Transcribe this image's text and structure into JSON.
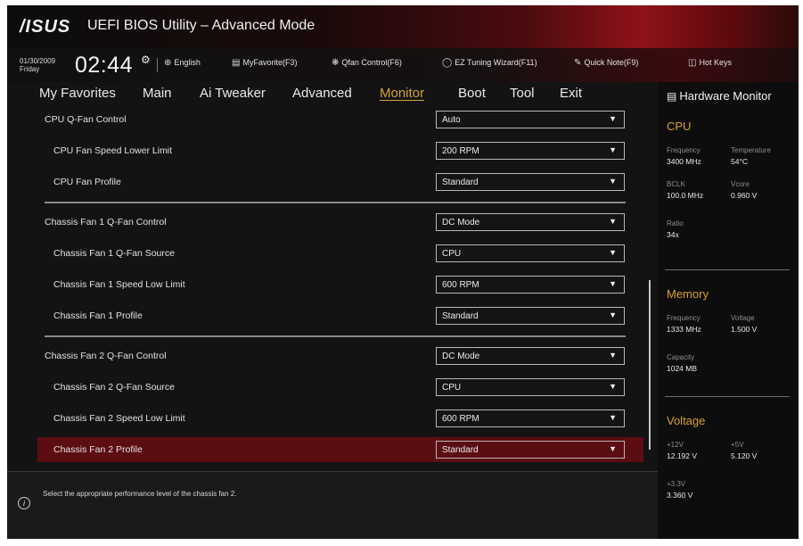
{
  "titlebar": {
    "logo": "/ISUS",
    "title": "UEFI BIOS Utility – Advanced Mode"
  },
  "toolbar": {
    "date": "01/30/2009",
    "day": "Friday",
    "time": "02:44",
    "items": [
      {
        "icon": "globe-icon",
        "label": "English"
      },
      {
        "icon": "favorites-icon",
        "label": "MyFavorite(F3)"
      },
      {
        "icon": "fan-icon",
        "label": "Qfan Control(F6)"
      },
      {
        "icon": "bulb-icon",
        "label": "EZ Tuning Wizard(F11)"
      },
      {
        "icon": "note-icon",
        "label": "Quick Note(F9)"
      },
      {
        "icon": "help-icon",
        "label": "Hot Keys"
      }
    ]
  },
  "tabs": [
    "My Favorites",
    "Main",
    "Ai Tweaker",
    "Advanced",
    "Monitor",
    "Boot",
    "Tool",
    "Exit"
  ],
  "active_tab": "Monitor",
  "settings": [
    {
      "label": "CPU Q-Fan Control",
      "value": "Auto"
    },
    {
      "label": "CPU Fan Speed Lower Limit",
      "value": "200 RPM"
    },
    {
      "label": "CPU Fan Profile",
      "value": "Standard"
    },
    {
      "label": "Chassis Fan 1 Q-Fan Control",
      "value": "DC Mode"
    },
    {
      "label": "Chassis Fan 1 Q-Fan Source",
      "value": "CPU"
    },
    {
      "label": "Chassis Fan 1 Speed Low Limit",
      "value": "600 RPM"
    },
    {
      "label": "Chassis Fan 1 Profile",
      "value": "Standard"
    },
    {
      "label": "Chassis Fan 2 Q-Fan Control",
      "value": "DC Mode"
    },
    {
      "label": "Chassis Fan 2 Q-Fan Source",
      "value": "CPU"
    },
    {
      "label": "Chassis Fan 2 Speed Low Limit",
      "value": "600 RPM"
    },
    {
      "label": "Chassis Fan 2 Profile",
      "value": "Standard"
    }
  ],
  "selected_setting": "Chassis Fan 2 Profile",
  "help_text": "Select the appropriate performance level of the chassis fan 2.",
  "hardware_monitor": {
    "title": "Hardware Monitor",
    "cpu": {
      "heading": "CPU",
      "frequency_label": "Frequency",
      "frequency": "3400 MHz",
      "temperature_label": "Temperature",
      "temperature": "54°C",
      "bclk_label": "BCLK",
      "bclk": "100.0 MHz",
      "vcore_label": "Vcore",
      "vcore": "0.960 V",
      "ratio_label": "Ratio",
      "ratio": "34x"
    },
    "memory": {
      "heading": "Memory",
      "frequency_label": "Frequency",
      "frequency": "1333 MHz",
      "voltage_label": "Voltage",
      "voltage": "1.500 V",
      "capacity_label": "Capacity",
      "capacity": "1024 MB"
    },
    "voltage": {
      "heading": "Voltage",
      "v12_label": "+12V",
      "v12": "12.192 V",
      "v5_label": "+5V",
      "v5": "5.120 V",
      "v33_label": "+3.3V",
      "v33": "3.360 V"
    }
  },
  "colors": {
    "accent": "#d6a02e",
    "highlight": "#5c0d12",
    "brand_red": "#8e1218"
  }
}
